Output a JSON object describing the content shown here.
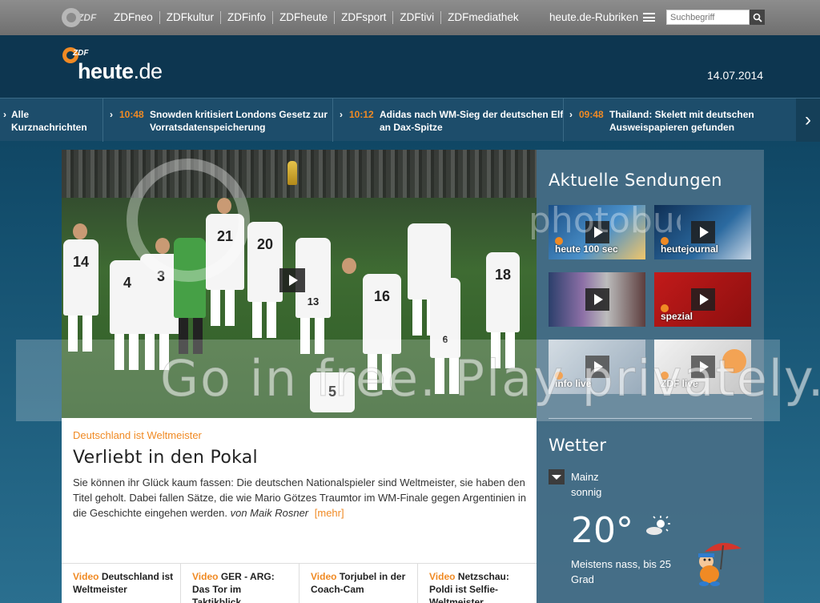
{
  "topbar": {
    "logo_text": "ZDF",
    "nav": [
      "ZDFneo",
      "ZDFkultur",
      "ZDFinfo",
      "ZDFheute",
      "ZDFsport",
      "ZDFtivi",
      "ZDFmediathek"
    ],
    "rubriken_label": "heute.de-Rubriken",
    "search_placeholder": "Suchbegriff"
  },
  "header": {
    "brand_main": "heute",
    "brand_suffix": ".de",
    "brand_badge": "ZDF",
    "date": "14.07.2014"
  },
  "ticker": {
    "all_line1": "Alle",
    "all_line2": "Kurznachrichten",
    "items": [
      {
        "time": "10:48",
        "headline": "Snowden kritisiert Londons Gesetz zur Vorratsdatenspeicherung"
      },
      {
        "time": "10:12",
        "headline": "Adidas nach WM-Sieg der deutschen Elf an Dax-Spitze"
      },
      {
        "time": "09:48",
        "headline": "Thailand: Skelett mit deutschen Ausweispapieren gefunden"
      }
    ]
  },
  "article": {
    "jersey_numbers": [
      "14",
      "4",
      "3",
      "21",
      "20",
      "13",
      "16",
      "18",
      "6",
      "5"
    ],
    "kicker": "Deutschland ist Weltmeister",
    "title": "Verliebt in den Pokal",
    "body": "Sie können ihr Glück kaum fassen: Die deutschen Nationalspieler sind Weltmeister, sie haben den Titel geholt. Dabei fallen Sätze, die wie Mario Götzes Traumtor im WM-Finale gegen Argentinien in die Geschichte eingehen werden.",
    "byline": "von Maik Rosner",
    "more": "[mehr]",
    "related": [
      {
        "tag": "Video",
        "title": "Deutschland ist Weltmeister"
      },
      {
        "tag": "Video",
        "title": "GER - ARG: Das Tor im Taktikblick"
      },
      {
        "tag": "Video",
        "title": "Torjubel in der Coach-Cam"
      },
      {
        "tag": "Video",
        "title": "Netzschau: Poldi ist Selfie-Weltmeister"
      }
    ]
  },
  "sidebar": {
    "title": "Aktuelle Sendungen",
    "shows": [
      {
        "label": "heute 100 sec",
        "color": "#2a6fa8"
      },
      {
        "label": "heutejournal",
        "color": "#3d6e9a"
      },
      {
        "label": "",
        "color": "#6a5f7a"
      },
      {
        "label": "spezial",
        "color": "#a41515"
      },
      {
        "label": "info live",
        "color": "#a8b6c2"
      },
      {
        "label": "ZDF live",
        "color": "#d8d8d8"
      }
    ],
    "weather_title": "Wetter",
    "city": "Mainz",
    "condition": "sonnig",
    "temperature": "20°",
    "forecast": "Meistens nass, bis 25 Grad"
  },
  "watermark": {
    "text": "Go in free. Play privately.",
    "logo": "photobucket"
  }
}
